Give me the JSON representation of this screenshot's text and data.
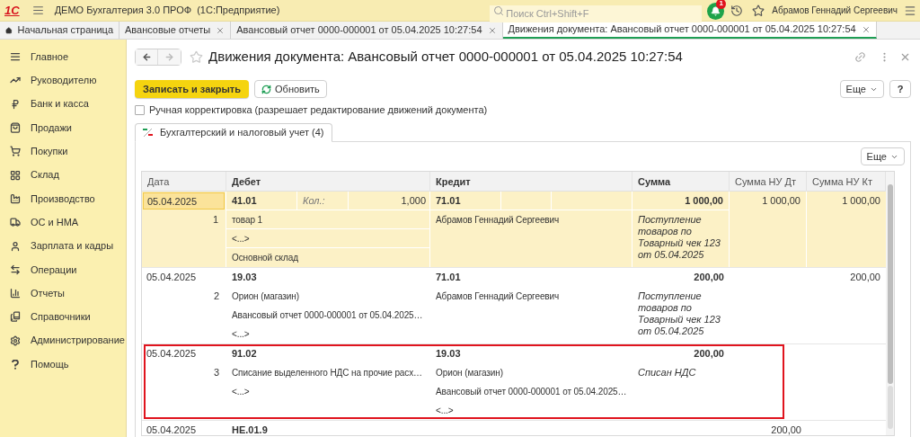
{
  "app_bar": {
    "logo": "1С",
    "title": "ДЕМО Бухгалтерия 3.0 ПРОФ  (1С:Предприятие)",
    "search": {
      "placeholder": "Поиск Ctrl+Shift+F"
    },
    "notifications": "1",
    "user": "Абрамов Геннадий Сергеевич"
  },
  "tabs": [
    {
      "label": "Начальная страница",
      "kind": "home",
      "selected": false
    },
    {
      "label": "Авансовые отчеты",
      "kind": "doc",
      "selected": false
    },
    {
      "label": "Авансовый отчет 0000-000001 от 05.04.2025 10:27:54",
      "kind": "doc",
      "selected": false
    },
    {
      "label": "Движения документа: Авансовый отчет 0000-000001 от 05.04.2025 10:27:54",
      "kind": "doc",
      "selected": true
    }
  ],
  "sidebar": {
    "items": [
      {
        "label": "Главное"
      },
      {
        "label": "Руководителю"
      },
      {
        "label": "Банк и касса"
      },
      {
        "label": "Продажи"
      },
      {
        "label": "Покупки"
      },
      {
        "label": "Склад"
      },
      {
        "label": "Производство"
      },
      {
        "label": "ОС и НМА"
      },
      {
        "label": "Зарплата и кадры"
      },
      {
        "label": "Операции"
      },
      {
        "label": "Отчеты"
      },
      {
        "label": "Справочники"
      },
      {
        "label": "Администрирование"
      },
      {
        "label": "Помощь"
      }
    ]
  },
  "form": {
    "title": "Движения документа: Авансовый отчет 0000-000001 от 05.04.2025 10:27:54",
    "save_button": "Записать и закрыть",
    "refresh_button": "Обновить",
    "more_button": "Еще",
    "help_button": "?",
    "manual_edit": {
      "label": "Ручная корректировка (разрешает редактирование движений документа)",
      "checked": false
    },
    "section_tabs": [
      {
        "label": "Бухгалтерский и налоговый учет (4)",
        "selected": true
      }
    ],
    "table_more_button": "Еще"
  },
  "table": {
    "columns": [
      "Дата",
      "Дебет",
      "Кредит",
      "Сумма",
      "Сумма НУ Дт",
      "Сумма НУ Кт"
    ],
    "rows": [
      {
        "selected": true,
        "marked": false,
        "date": "05.04.2025",
        "number": "1",
        "debit": {
          "account": "41.01",
          "qty_label": "Кол.:",
          "qty": "1,000",
          "lines": [
            "товар 1",
            "<...>",
            "Основной склад"
          ]
        },
        "credit": {
          "account": "71.01",
          "lines": [
            "Абрамов Геннадий Сергеевич"
          ]
        },
        "sum": "1 000,00",
        "content": "Поступление товаров по Товарный чек 123 от 05.04.2025",
        "nu_dt": "1 000,00",
        "nu_kt": "1 000,00"
      },
      {
        "selected": false,
        "marked": false,
        "date": "05.04.2025",
        "number": "2",
        "debit": {
          "account": "19.03",
          "lines": [
            "Орион (магазин)",
            "Авансовый отчет 0000-000001 от 05.04.2025…",
            "<...>"
          ]
        },
        "credit": {
          "account": "71.01",
          "lines": [
            "Абрамов Геннадий Сергеевич"
          ]
        },
        "sum": "200,00",
        "content": "Поступление товаров по Товарный чек 123 от 05.04.2025",
        "nu_kt": "200,00"
      },
      {
        "selected": false,
        "marked": true,
        "date": "05.04.2025",
        "number": "3",
        "debit": {
          "account": "91.02",
          "lines": [
            "Списание выделенного НДС на прочие расх…",
            "<...>"
          ]
        },
        "credit": {
          "account": "19.03",
          "lines": [
            "Орион (магазин)",
            "Авансовый отчет 0000-000001 от 05.04.2025…",
            "<...>"
          ]
        },
        "sum": "200,00",
        "content": "Списан НДС"
      },
      {
        "selected": false,
        "marked": false,
        "date": "05.04.2025",
        "debit": {
          "account": "НЕ.01.9"
        },
        "nu_dt": "200,00"
      }
    ]
  }
}
